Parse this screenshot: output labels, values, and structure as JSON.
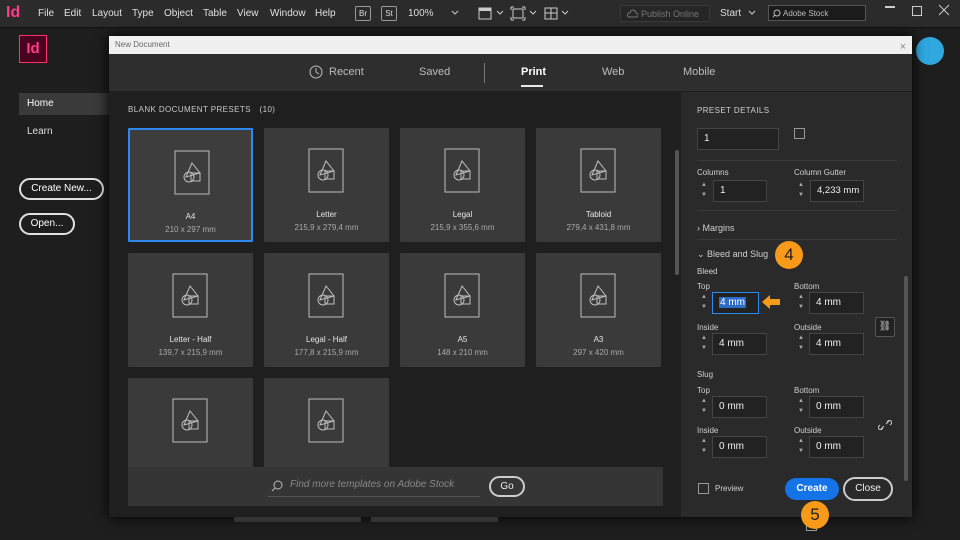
{
  "menubar": {
    "app_glyph": "Id",
    "items": [
      "File",
      "Edit",
      "Layout",
      "Type",
      "Object",
      "Table",
      "View",
      "Window",
      "Help"
    ],
    "bridge": "Br",
    "stock": "St",
    "zoom": "100%",
    "publish": "Publish Online",
    "workspace": "Start",
    "search_placeholder": "Adobe Stock"
  },
  "home": {
    "logo": "Id",
    "nav_home": "Home",
    "nav_learn": "Learn",
    "create_new": "Create New...",
    "open": "Open..."
  },
  "dialog": {
    "title": "New Document",
    "close_glyph": "×",
    "tabs": [
      "Recent",
      "Saved",
      "Print",
      "Web",
      "Mobile"
    ],
    "active_tab": "Print",
    "presets_header": "BLANK DOCUMENT PRESETS",
    "presets_count": "(10)",
    "presets": [
      {
        "name": "A4",
        "size": "210 x 297 mm",
        "selected": true
      },
      {
        "name": "Letter",
        "size": "215,9 x 279,4 mm"
      },
      {
        "name": "Legal",
        "size": "215,9 x 355,6 mm"
      },
      {
        "name": "Tabloid",
        "size": "279,4 x 431,8 mm"
      },
      {
        "name": "Letter - Half",
        "size": "139,7 x 215,9 mm"
      },
      {
        "name": "Legal - Half",
        "size": "177,8 x 215,9 mm"
      },
      {
        "name": "A5",
        "size": "148 x 210 mm"
      },
      {
        "name": "A3",
        "size": "297 x 420 mm"
      },
      {
        "name": "",
        "size": ""
      },
      {
        "name": "",
        "size": ""
      }
    ],
    "template_search_placeholder": "Find more templates on Adobe Stock",
    "go": "Go",
    "details": {
      "header": "PRESET DETAILS",
      "pages_value": "1",
      "columns_label": "Columns",
      "columns_value": "1",
      "gutter_label": "Column Gutter",
      "gutter_value": "4,233 mm",
      "margins_label": "Margins",
      "bleed_slug_label": "Bleed and Slug",
      "bleed_label": "Bleed",
      "bleed": {
        "top_label": "Top",
        "top": "4 mm",
        "bottom_label": "Bottom",
        "bottom": "4 mm",
        "inside_label": "Inside",
        "inside": "4 mm",
        "outside_label": "Outside",
        "outside": "4 mm"
      },
      "slug_label": "Slug",
      "slug": {
        "top_label": "Top",
        "top": "0 mm",
        "bottom_label": "Bottom",
        "bottom": "0 mm",
        "inside_label": "Inside",
        "inside": "0 mm",
        "outside_label": "Outside",
        "outside": "0 mm"
      },
      "preview_label": "Preview"
    },
    "create": "Create",
    "close": "Close"
  },
  "callouts": {
    "step4": "4",
    "step5": "5"
  },
  "colors": {
    "accent": "#1473e6",
    "callout": "#f79a1a",
    "selection": "#2d89ef"
  }
}
